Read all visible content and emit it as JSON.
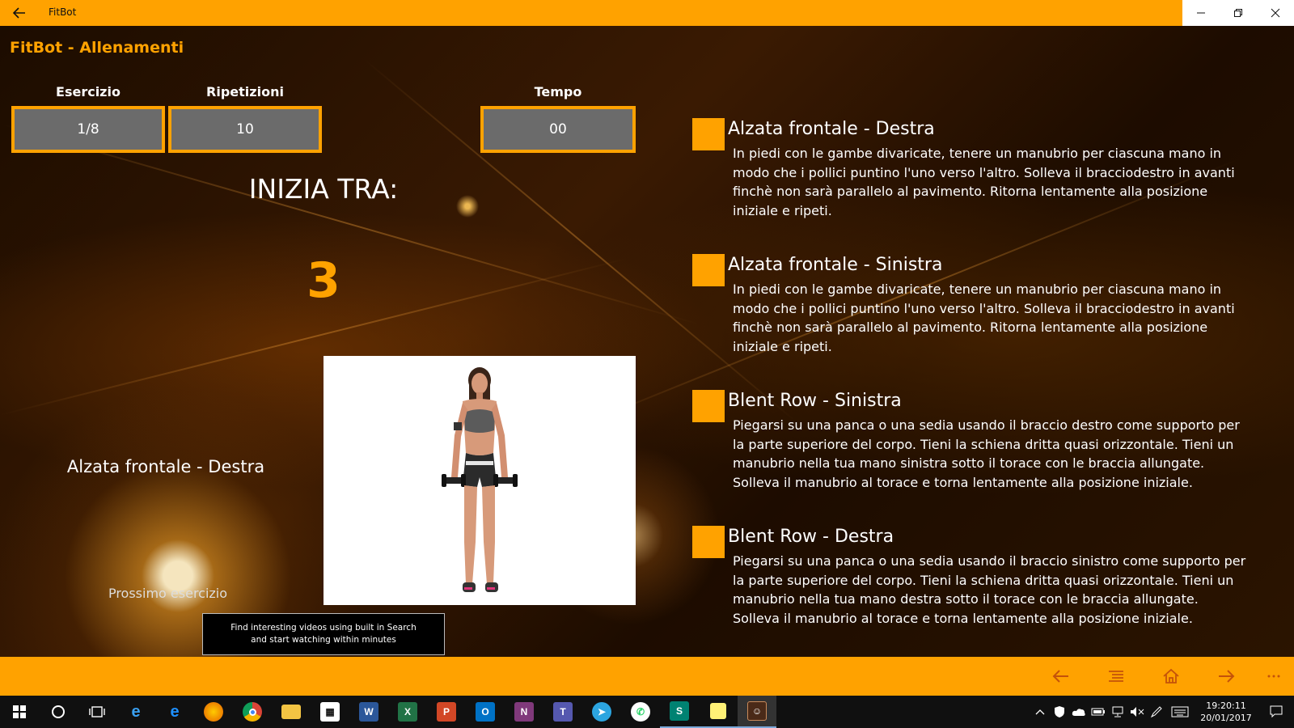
{
  "window": {
    "title": "FitBot"
  },
  "page": {
    "title": "FitBot - Allenamenti"
  },
  "stats": {
    "esercizio_label": "Esercizio",
    "esercizio_value": "1/8",
    "ripetizioni_label": "Ripetizioni",
    "ripetizioni_value": "10",
    "tempo_label": "Tempo",
    "tempo_value": "00"
  },
  "countdown": {
    "label": "INIZIA TRA:",
    "value": "3"
  },
  "current_exercise": {
    "name": "Alzata frontale - Destra",
    "next_label": "Prossimo esercizio"
  },
  "tooltip": {
    "line1": "Find interesting videos using built in Search",
    "line2": "and start watching within minutes"
  },
  "exercises": [
    {
      "name": "Alzata frontale - Destra",
      "description": "In piedi con le gambe divaricate, tenere un manubrio per ciascuna mano in modo che i pollici puntino l'uno verso l'altro. Solleva il bracciodestro in avanti finchè non sarà parallelo al pavimento. Ritorna lentamente alla posizione iniziale e ripeti."
    },
    {
      "name": "Alzata frontale - Sinistra",
      "description": "In piedi con le gambe divaricate, tenere un manubrio per ciascuna mano in modo che i pollici puntino l'uno verso l'altro. Solleva il bracciodestro in avanti finchè non sarà parallelo al pavimento. Ritorna lentamente alla posizione iniziale e ripeti."
    },
    {
      "name": "Blent Row - Sinistra",
      "description": "Piegarsi su una panca o una sedia usando il braccio destro come supporto per la parte superiore del corpo. Tieni la schiena dritta quasi orizzontale. Tieni un manubrio nella tua mano sinistra sotto il torace con le braccia allungate. Solleva il manubrio al torace e torna lentamente alla posizione iniziale."
    },
    {
      "name": "Blent Row - Destra",
      "description": "Piegarsi su una panca o una sedia usando il braccio sinistro come supporto per la parte superiore del corpo. Tieni la schiena dritta quasi orizzontale. Tieni un manubrio nella tua mano destra sotto il torace con le braccia allungate. Solleva il manubrio al torace e torna lentamente alla posizione iniziale."
    }
  ],
  "taskbar": {
    "time": "19:20:11",
    "date": "20/01/2017",
    "apps": [
      "Word",
      "Excel",
      "PowerPoint",
      "Outlook",
      "OneNote",
      "Teams",
      "Telegram",
      "WhatsApp",
      "Sway",
      "Sticky Notes",
      "FitBot"
    ]
  },
  "colors": {
    "accent": "#FFA200",
    "box_fill": "#6b6b6b",
    "taskbar": "#101010"
  }
}
